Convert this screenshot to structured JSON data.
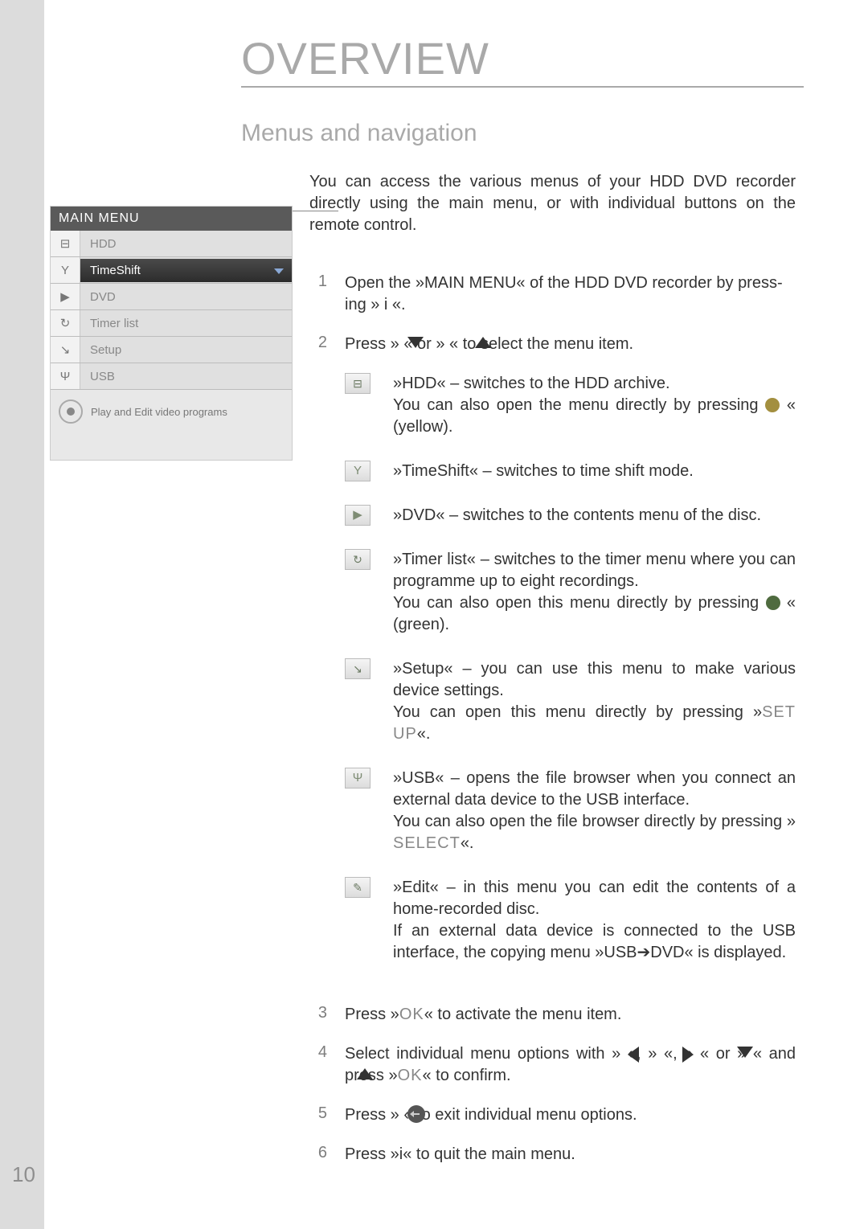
{
  "page_number": "10",
  "title": "OVERVIEW",
  "subtitle": "Menus and navigation",
  "intro": "You can access the various menus of your HDD DVD recorder directly using the main menu, or with individual buttons on the remote control.",
  "menu": {
    "title": "MAIN MENU",
    "caption": "Play and Edit video programs",
    "items": [
      {
        "icon": "⊟",
        "label": "HDD"
      },
      {
        "icon": "Y",
        "label": "TimeShift"
      },
      {
        "icon": "▶",
        "label": "DVD"
      },
      {
        "icon": "↻",
        "label": "Timer list"
      },
      {
        "icon": "↘",
        "label": "Setup"
      },
      {
        "icon": "Ψ",
        "label": "USB"
      }
    ]
  },
  "step1_a": "Open the »MAIN MENU« of the HDD DVD recorder by press-",
  "step1_b": "ing » i «.",
  "step2": "Press »        « or »        « to select the menu item.",
  "items_list": [
    {
      "icon": "⊟",
      "txt_a": "»HDD« – switches to the HDD archive.",
      "txt_b": "You can also open the menu directly by pressing ",
      "txt_c": " « (yellow)."
    },
    {
      "icon": "Y",
      "txt_a": "»TimeShift« – switches to time shift mode."
    },
    {
      "icon": "▶",
      "txt_a": "»DVD« – switches to the contents menu of the disc."
    },
    {
      "icon": "↻",
      "txt_a": "»Timer list« – switches to the timer menu where you can programme up to eight recordings.",
      "txt_b": "You can also open this menu directly by pressing ",
      "txt_c": " « (green)."
    },
    {
      "icon": "↘",
      "txt_a": "»Setup« – you can use this menu to make various device settings.",
      "txt_b": "You can open this menu directly by pressing »",
      "kw": "SET UP",
      "txt_c": "«."
    },
    {
      "icon": "Ψ",
      "txt_a": "»USB« – opens the file browser when you connect an external data device to the USB interface.",
      "txt_b": "You can also open the file browser directly by pressing » ",
      "kw": "SELECT",
      "txt_c": "«."
    },
    {
      "icon": "✎",
      "txt_a": "»Edit« – in this menu you can edit the contents of a home-recorded disc.",
      "txt_b": "If an external data device is connected to the USB interface, the copying menu »USB➔DVD« is displayed."
    }
  ],
  "step3_a": "Press »",
  "step3_kw": "OK",
  "step3_b": "« to activate the menu item.",
  "step4_a": "Select individual menu options with »   «, »   «, »   « or »   « and press »",
  "step4_kw": "OK",
  "step4_b": "« to confirm.",
  "step5_a": "Press »   « to exit individual menu options.",
  "step6": "Press »i« to quit the main menu."
}
